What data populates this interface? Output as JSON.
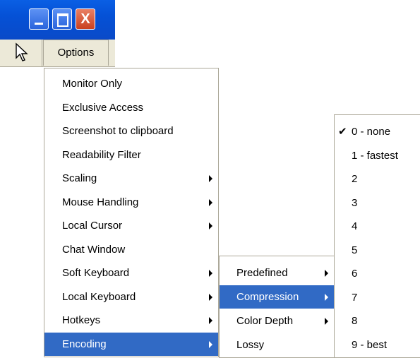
{
  "window": {
    "close_glyph": "X"
  },
  "menubar": {
    "options_label": "Options"
  },
  "options_menu": {
    "items": [
      {
        "label": "Monitor Only",
        "has_submenu": false
      },
      {
        "label": "Exclusive Access",
        "has_submenu": false
      },
      {
        "label": "Screenshot to clipboard",
        "has_submenu": false
      },
      {
        "label": "Readability Filter",
        "has_submenu": false
      },
      {
        "label": "Scaling",
        "has_submenu": true
      },
      {
        "label": "Mouse Handling",
        "has_submenu": true
      },
      {
        "label": "Local Cursor",
        "has_submenu": true
      },
      {
        "label": "Chat Window",
        "has_submenu": false
      },
      {
        "label": "Soft Keyboard",
        "has_submenu": true
      },
      {
        "label": "Local Keyboard",
        "has_submenu": true
      },
      {
        "label": "Hotkeys",
        "has_submenu": true
      },
      {
        "label": "Encoding",
        "has_submenu": true,
        "selected": true
      }
    ]
  },
  "encoding_menu": {
    "items": [
      {
        "label": "Predefined",
        "has_submenu": true
      },
      {
        "label": "Compression",
        "has_submenu": true,
        "selected": true
      },
      {
        "label": "Color Depth",
        "has_submenu": true
      },
      {
        "label": "Lossy",
        "has_submenu": false
      }
    ]
  },
  "compression_menu": {
    "check_glyph": "✔",
    "items": [
      {
        "label": "0 - none",
        "checked": true
      },
      {
        "label": "1 - fastest"
      },
      {
        "label": "2"
      },
      {
        "label": "3"
      },
      {
        "label": "4"
      },
      {
        "label": "5"
      },
      {
        "label": "6"
      },
      {
        "label": "7"
      },
      {
        "label": "8"
      },
      {
        "label": "9 - best"
      }
    ]
  },
  "colors": {
    "title_blue": "#0551d6",
    "menu_bg": "#ece9d8",
    "highlight": "#316ac5"
  }
}
